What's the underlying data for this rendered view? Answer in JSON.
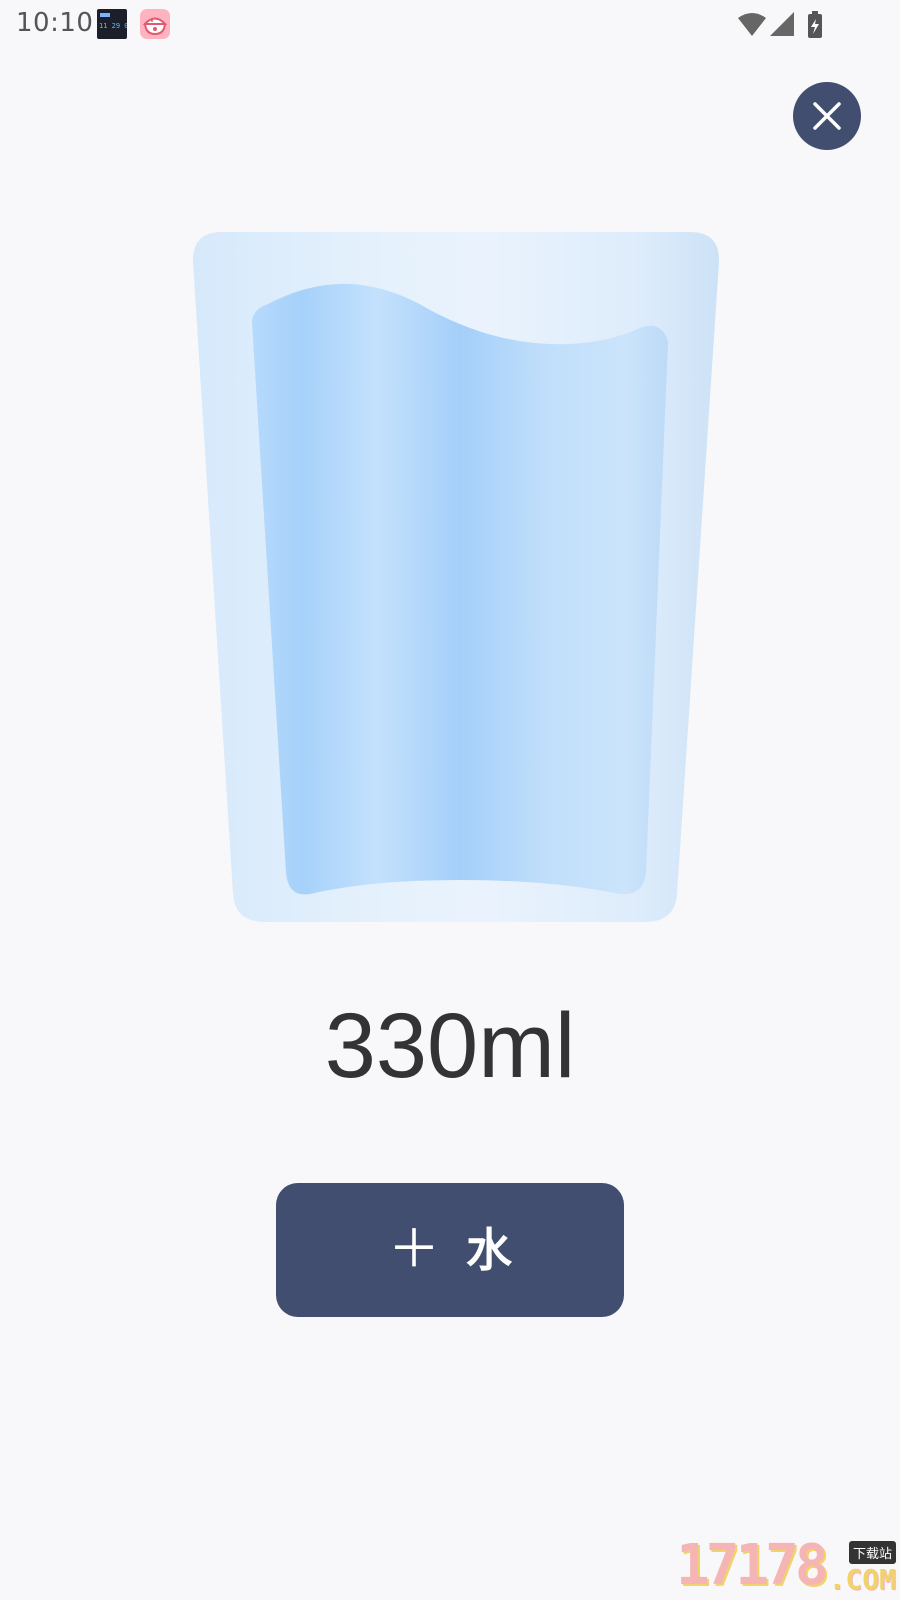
{
  "status_bar": {
    "time": "10:10",
    "notification_icons": [
      "clock-widget-icon",
      "rice-bowl-app-icon"
    ],
    "clock_widget_digits": "11 29 03",
    "system_icons": [
      "wifi-icon",
      "cell-signal-icon",
      "battery-charging-icon"
    ]
  },
  "close_button": {
    "icon": "close-icon"
  },
  "glass": {
    "icon": "water-glass"
  },
  "amount": {
    "value": "330ml"
  },
  "add_button": {
    "plus": "＋",
    "label": "水"
  },
  "watermark": {
    "digits": "17178",
    "tag": "下载站",
    "suffix": ".COM"
  },
  "colors": {
    "accent": "#424e6f",
    "background": "#f8f8fa",
    "water": "#a9d4fb",
    "glass": "#dcecfb",
    "text": "#333336"
  }
}
